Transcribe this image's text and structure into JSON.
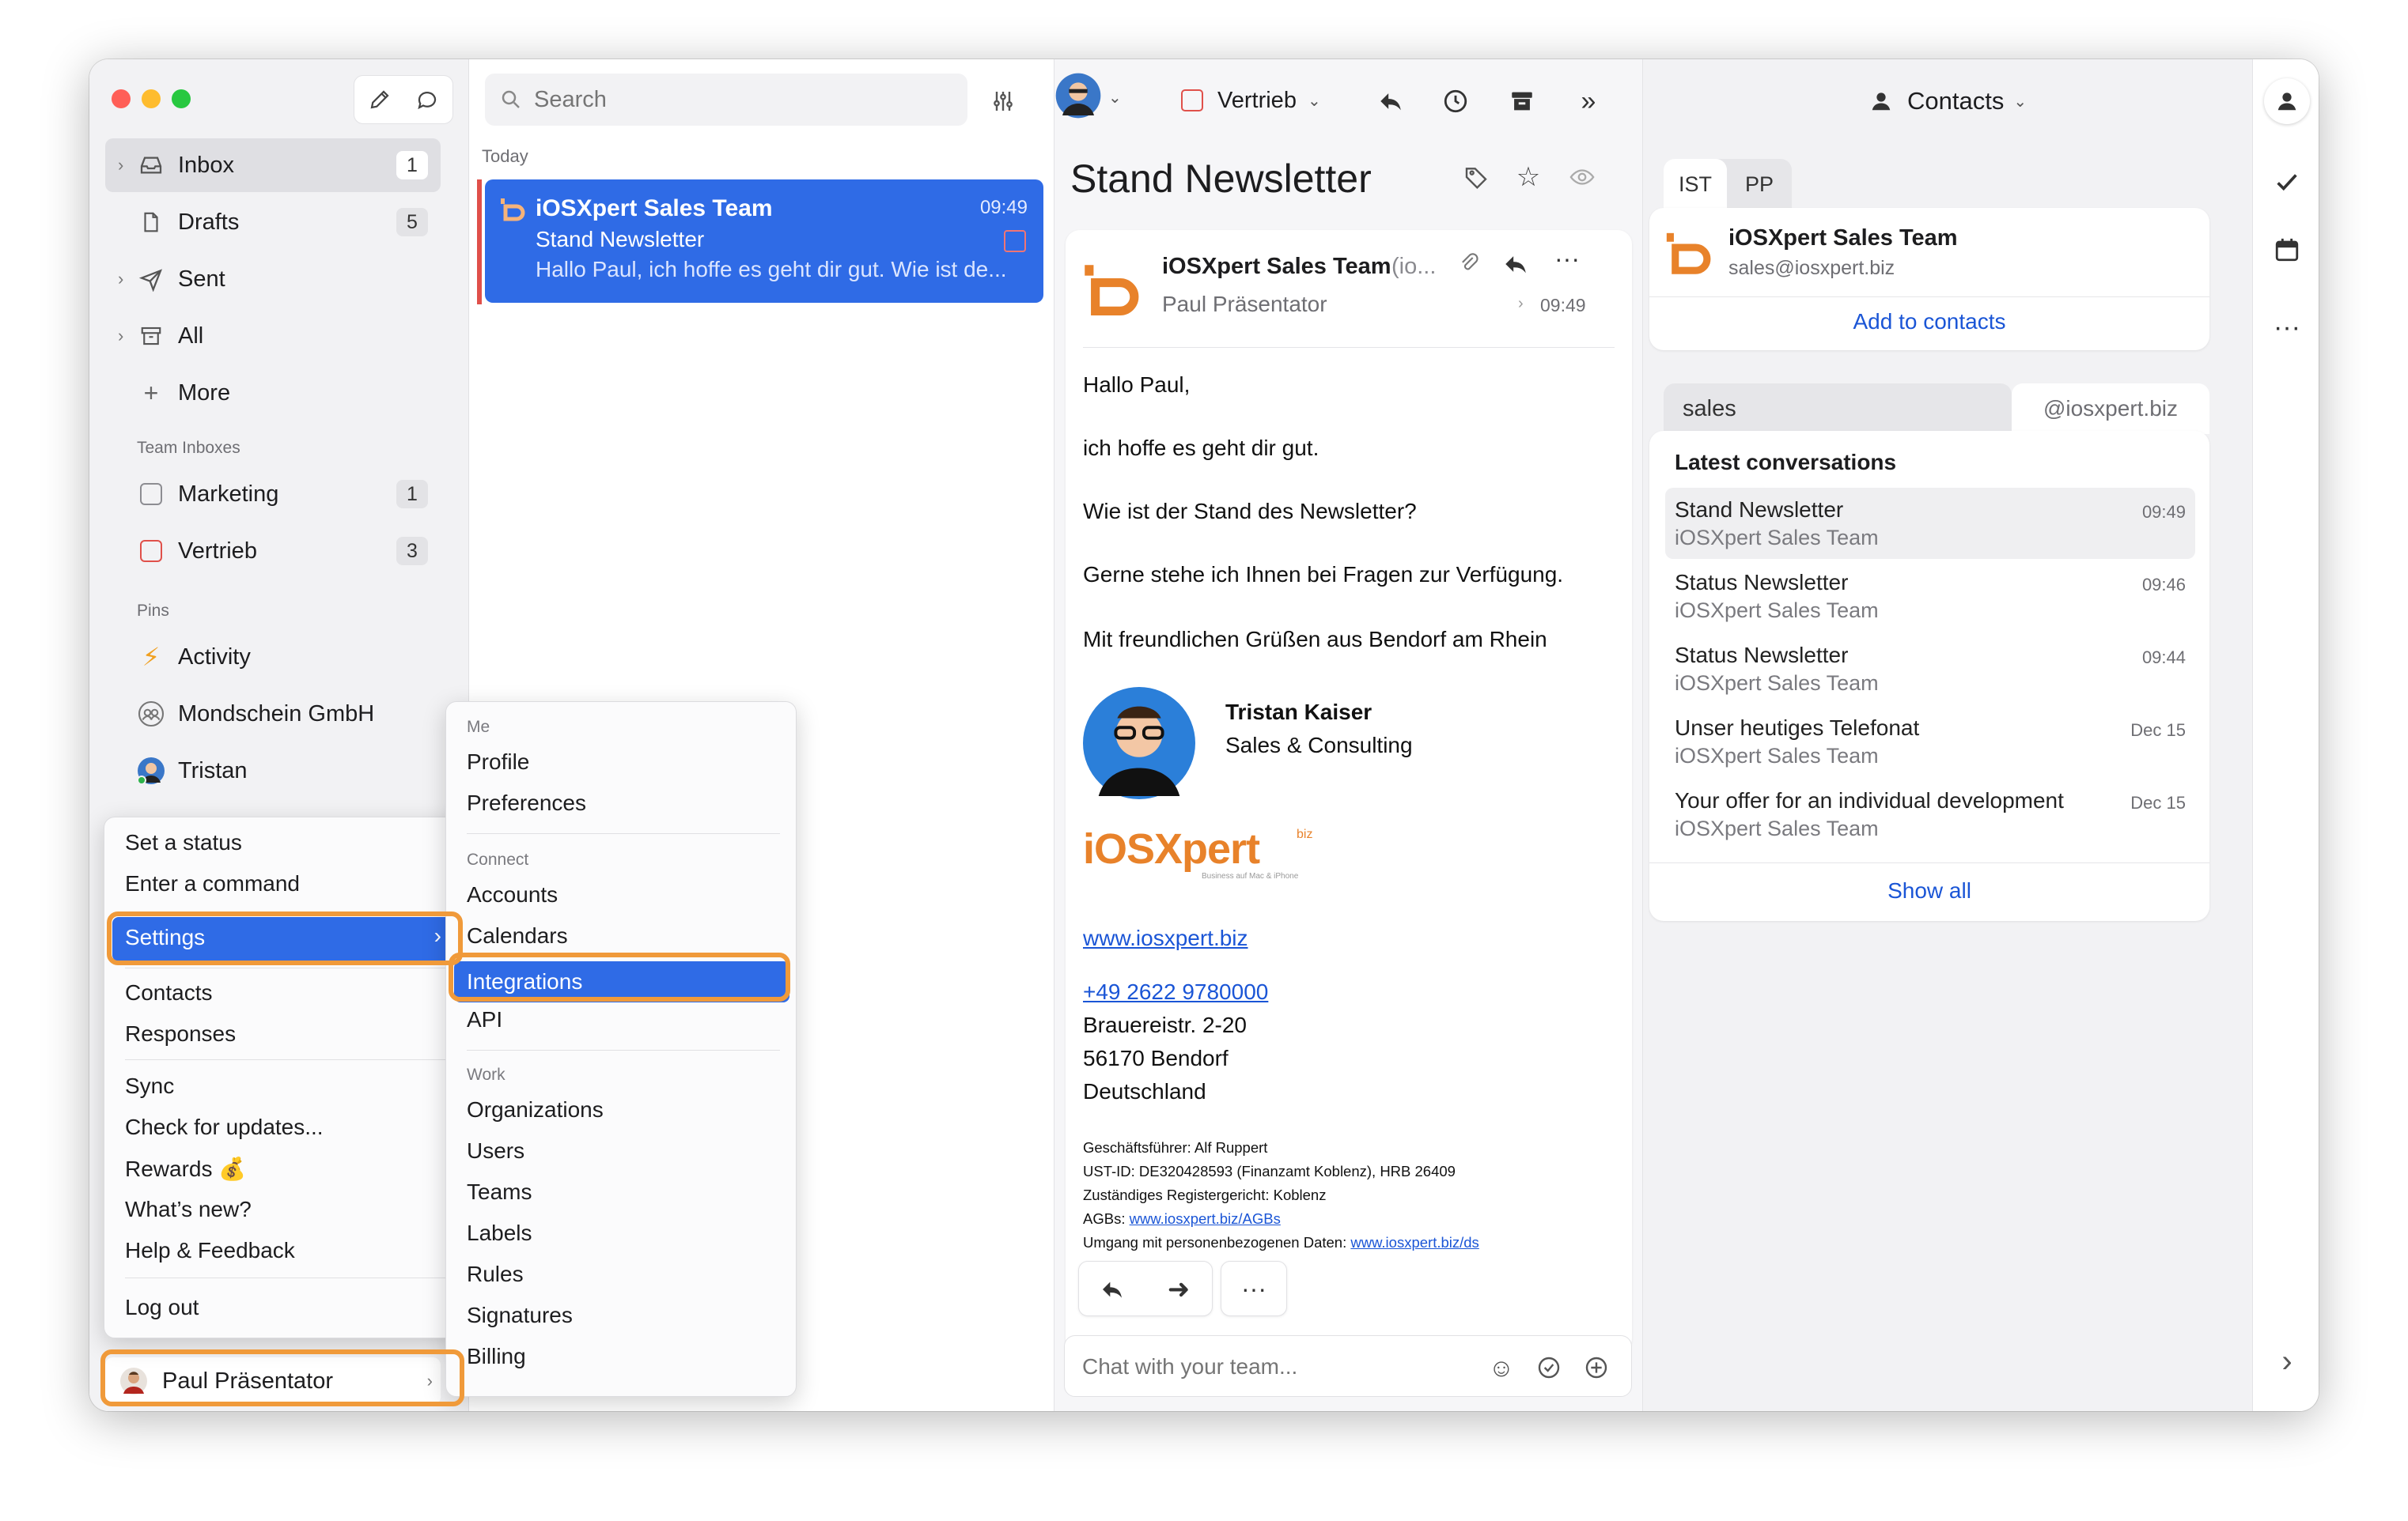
{
  "sidebar": {
    "items": [
      {
        "label": "Inbox",
        "count": "1"
      },
      {
        "label": "Drafts",
        "count": "5"
      },
      {
        "label": "Sent"
      },
      {
        "label": "All"
      },
      {
        "label": "More"
      }
    ],
    "team_inboxes_header": "Team Inboxes",
    "team_inboxes": [
      {
        "label": "Marketing",
        "count": "1"
      },
      {
        "label": "Vertrieb",
        "count": "3"
      }
    ],
    "pins_header": "Pins",
    "pins": [
      {
        "label": "Activity"
      },
      {
        "label": "Mondschein GmbH"
      },
      {
        "label": "Tristan"
      }
    ],
    "user_name": "Paul Präsentator"
  },
  "user_menu": {
    "items": [
      "Set a status",
      "Enter a command",
      "Settings",
      "Contacts",
      "Responses",
      "Sync",
      "Check for updates...",
      "Rewards 💰",
      "What’s new?",
      "Help & Feedback",
      "Log out"
    ]
  },
  "settings_menu": {
    "me_header": "Me",
    "me": [
      "Profile",
      "Preferences"
    ],
    "connect_header": "Connect",
    "connect": [
      "Accounts",
      "Calendars",
      "Integrations",
      "API"
    ],
    "work_header": "Work",
    "work": [
      "Organizations",
      "Users",
      "Teams",
      "Labels",
      "Rules",
      "Signatures",
      "Billing"
    ]
  },
  "search": {
    "placeholder": "Search"
  },
  "list": {
    "section": "Today",
    "items": [
      {
        "sender": "iOSXpert Sales Team",
        "time": "09:49",
        "subject": "Stand Newsletter",
        "preview": "Hallo Paul, ich hoffe es geht dir gut. Wie ist de..."
      }
    ]
  },
  "toolbar": {
    "label": "Vertrieb",
    "contacts": "Contacts"
  },
  "reader": {
    "subject": "Stand Newsletter",
    "from": "iOSXpert Sales Team",
    "from_suffix": "(io...",
    "to": "Paul Präsentator",
    "time": "09:49",
    "body": [
      "Hallo Paul,",
      "ich hoffe es geht dir gut.",
      "Wie ist der Stand des Newsletter?",
      "Gerne stehe ich Ihnen bei Fragen zur Verfügung.",
      "Mit freundlichen Grüßen aus Bendorf am Rhein"
    ],
    "sig_name": "Tristan Kaiser",
    "sig_title": "Sales & Consulting",
    "logo_main": "iOSXpert",
    "logo_suffix": "biz",
    "logo_tagline": "Business auf Mac & iPhone",
    "website": "www.iosxpert.biz",
    "phone": "+49 2622 9780000",
    "address": [
      "Brauereistr. 2-20",
      "56170 Bendorf",
      "Deutschland"
    ],
    "legal": [
      "Geschäftsführer: Alf Ruppert",
      "UST-ID: DE320428593 (Finanzamt Koblenz), HRB 26409",
      "Zuständiges Registergericht: Koblenz"
    ],
    "agbs_label": "AGBs: ",
    "agbs_link": "www.iosxpert.biz/AGBs",
    "privacy_label": "Umgang mit personenbezogenen Daten: ",
    "privacy_link": "www.iosxpert.biz/ds",
    "chat_placeholder": "Chat with your team..."
  },
  "contacts": {
    "tabs": [
      "IST",
      "PP"
    ],
    "name": "iOSXpert Sales Team",
    "email": "sales@iosxpert.biz",
    "add": "Add to contacts",
    "search_tab": "sales",
    "domain_tab": "@iosxpert.biz",
    "latest": "Latest conversations",
    "conversations": [
      {
        "title": "Stand Newsletter",
        "sub": "iOSXpert Sales Team",
        "time": "09:49"
      },
      {
        "title": "Status Newsletter",
        "sub": "iOSXpert Sales Team",
        "time": "09:46"
      },
      {
        "title": "Status Newsletter",
        "sub": "iOSXpert Sales Team",
        "time": "09:44"
      },
      {
        "title": "Unser heutiges Telefonat",
        "sub": "iOSXpert Sales Team",
        "time": "Dec 15"
      },
      {
        "title": "Your offer for an individual development",
        "sub": "iOSXpert Sales Team",
        "time": "Dec 15"
      }
    ],
    "show_all": "Show all"
  },
  "colors": {
    "accent": "#2f6be6",
    "highlight": "#f09a3a",
    "brand_orange": "#e8822a"
  }
}
